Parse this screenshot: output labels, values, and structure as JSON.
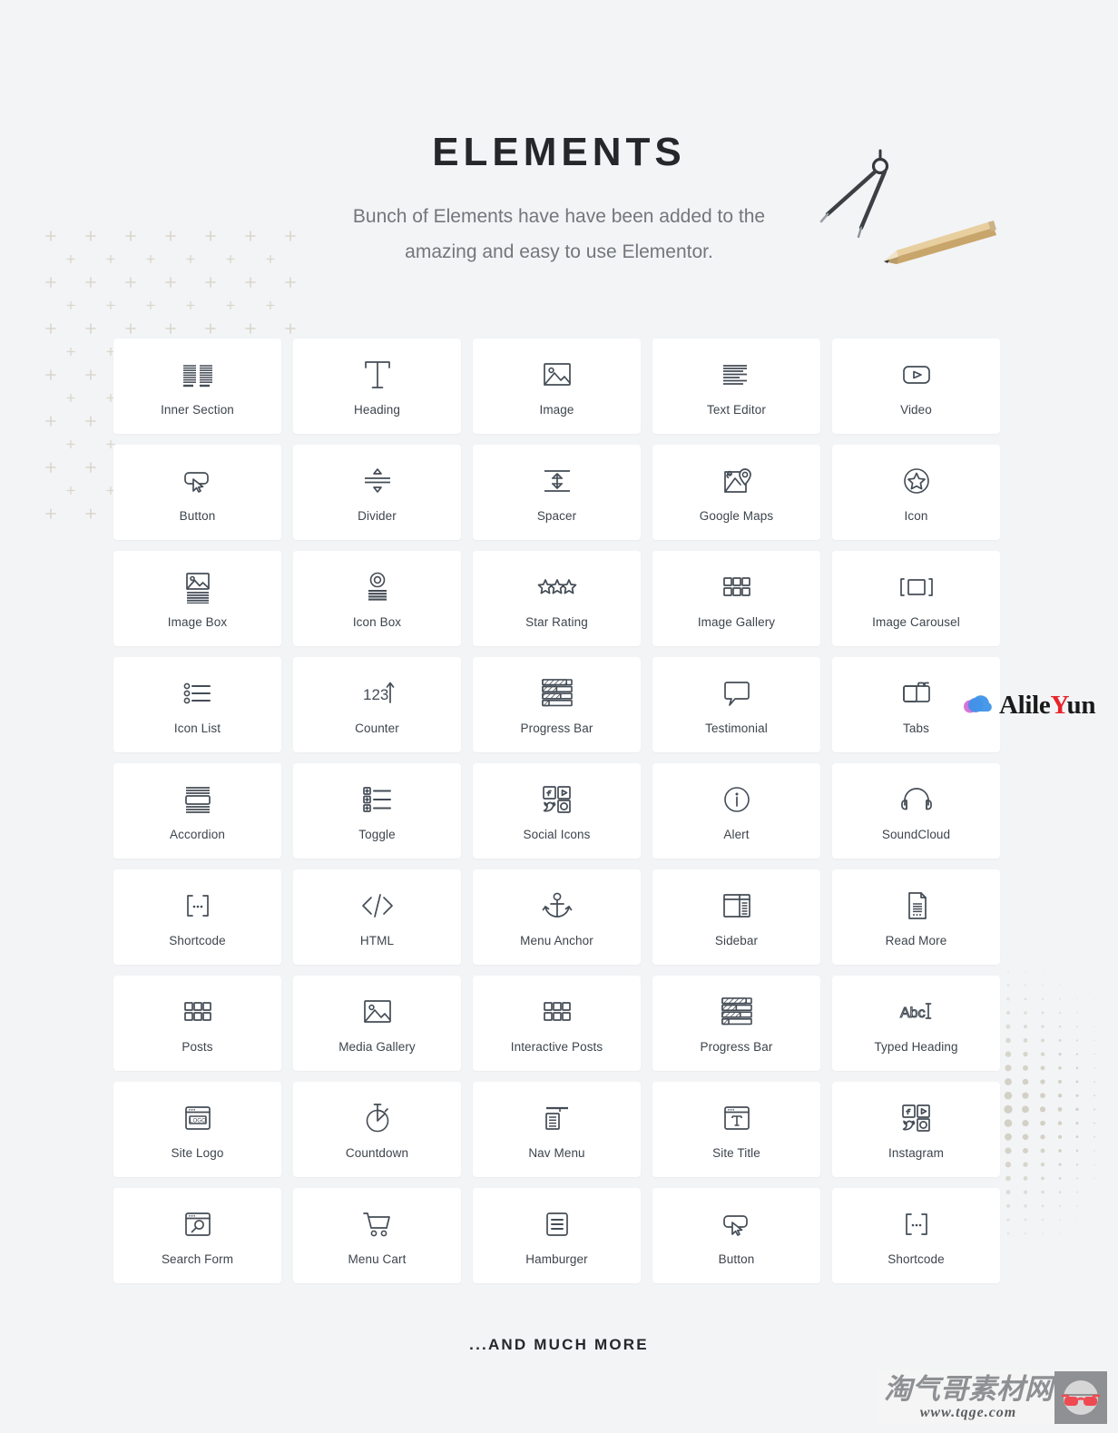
{
  "header": {
    "title": "ELEMENTS",
    "subtitle": "Bunch of Elements have have been added to the amazing and easy to use  Elementor."
  },
  "footer": {
    "text": "...AND MUCH MORE"
  },
  "watermarks": {
    "alileyun": {
      "prefix": "Alile",
      "accent": "Y",
      "suffix": "un",
      "accent_color": "#e8232a",
      "icon": "cloud-icon"
    },
    "tqge": {
      "chinese": "淘气哥素材网",
      "url": "www.tqge.com",
      "icon": "glasses-icon"
    }
  },
  "illustration": {
    "items": [
      "compass-icon",
      "pencil-icon"
    ]
  },
  "decorations": {
    "left_pattern": "plus-grid-pattern",
    "right_pattern": "halftone-dot-pattern",
    "pattern_color": "#d9d6cb"
  },
  "colors": {
    "page_background": "#f3f4f6",
    "card_background": "#ffffff",
    "icon_stroke": "#444c56",
    "label_text": "#3d444c",
    "title_text": "#25272b",
    "subtitle_text": "#72777d"
  },
  "elements": [
    {
      "label": "Inner Section",
      "icon": "inner-section-icon"
    },
    {
      "label": "Heading",
      "icon": "heading-t-icon"
    },
    {
      "label": "Image",
      "icon": "image-icon"
    },
    {
      "label": "Text Editor",
      "icon": "text-editor-icon"
    },
    {
      "label": "Video",
      "icon": "video-play-icon"
    },
    {
      "label": "Button",
      "icon": "button-cursor-icon"
    },
    {
      "label": "Divider",
      "icon": "divider-icon"
    },
    {
      "label": "Spacer",
      "icon": "spacer-icon"
    },
    {
      "label": "Google Maps",
      "icon": "google-maps-icon"
    },
    {
      "label": "Icon",
      "icon": "star-circle-icon"
    },
    {
      "label": "Image Box",
      "icon": "image-box-icon"
    },
    {
      "label": "Icon Box",
      "icon": "icon-box-icon"
    },
    {
      "label": "Star Rating",
      "icon": "star-rating-icon"
    },
    {
      "label": "Image Gallery",
      "icon": "grid-gallery-icon"
    },
    {
      "label": "Image Carousel",
      "icon": "carousel-icon"
    },
    {
      "label": "Icon List",
      "icon": "icon-list-icon"
    },
    {
      "label": "Counter",
      "icon": "counter-123-icon"
    },
    {
      "label": "Progress Bar",
      "icon": "progress-bar-icon"
    },
    {
      "label": "Testimonial",
      "icon": "speech-bubble-icon"
    },
    {
      "label": "Tabs",
      "icon": "tabs-folder-icon"
    },
    {
      "label": "Accordion",
      "icon": "accordion-icon"
    },
    {
      "label": "Toggle",
      "icon": "toggle-list-icon"
    },
    {
      "label": "Social Icons",
      "icon": "social-icons-icon"
    },
    {
      "label": "Alert",
      "icon": "info-circle-icon"
    },
    {
      "label": "SoundCloud",
      "icon": "headphones-icon"
    },
    {
      "label": "Shortcode",
      "icon": "shortcode-brackets-icon"
    },
    {
      "label": "HTML",
      "icon": "code-angle-brackets-icon"
    },
    {
      "label": "Menu Anchor",
      "icon": "anchor-icon"
    },
    {
      "label": "Sidebar",
      "icon": "sidebar-layout-icon"
    },
    {
      "label": "Read More",
      "icon": "document-page-icon"
    },
    {
      "label": "Posts",
      "icon": "grid-gallery-icon"
    },
    {
      "label": "Media Gallery",
      "icon": "image-icon"
    },
    {
      "label": "Interactive Posts",
      "icon": "grid-gallery-icon"
    },
    {
      "label": "Progress Bar",
      "icon": "progress-bar-icon"
    },
    {
      "label": "Typed Heading",
      "icon": "typed-heading-abc-icon"
    },
    {
      "label": "Site Logo",
      "icon": "site-logo-browser-icon"
    },
    {
      "label": "Countdown",
      "icon": "stopwatch-icon"
    },
    {
      "label": "Nav Menu",
      "icon": "nav-menu-icon"
    },
    {
      "label": "Site Title",
      "icon": "site-title-browser-icon"
    },
    {
      "label": "Instagram",
      "icon": "social-icons-icon"
    },
    {
      "label": "Search Form",
      "icon": "search-browser-icon"
    },
    {
      "label": "Menu Cart",
      "icon": "shopping-cart-icon"
    },
    {
      "label": "Hamburger",
      "icon": "hamburger-icon"
    },
    {
      "label": "Button",
      "icon": "button-cursor-icon"
    },
    {
      "label": "Shortcode",
      "icon": "shortcode-brackets-icon"
    }
  ]
}
